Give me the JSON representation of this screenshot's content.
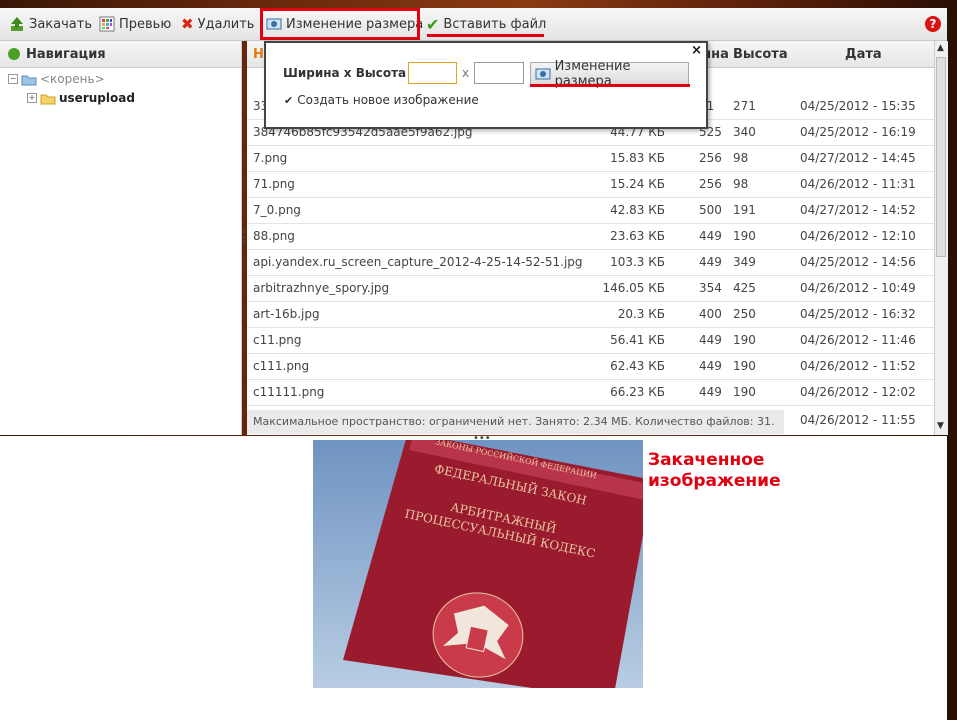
{
  "toolbar": {
    "upload_label": "Закачать",
    "preview_label": "Превью",
    "delete_label": "Удалить",
    "resize_label": "Изменение размера",
    "paste_label": "Вставить файл"
  },
  "nav": {
    "title": "Навигация",
    "root": "<корень>",
    "folder": "userupload"
  },
  "files": {
    "header": {
      "name": "Н",
      "width_tail": "ина",
      "height": "Высота",
      "date": "Дата"
    },
    "rows": [
      {
        "name": "33",
        "size": "",
        "w": "41",
        "h": "271",
        "date": "04/25/2012 - 15:35"
      },
      {
        "name": "384746b85fc93542d5aae5f9a62.jpg",
        "size": "44.77 КБ",
        "w": "525",
        "h": "340",
        "date": "04/25/2012 - 16:19"
      },
      {
        "name": "7.png",
        "size": "15.83 КБ",
        "w": "256",
        "h": "98",
        "date": "04/27/2012 - 14:45"
      },
      {
        "name": "71.png",
        "size": "15.24 КБ",
        "w": "256",
        "h": "98",
        "date": "04/26/2012 - 11:31"
      },
      {
        "name": "7_0.png",
        "size": "42.83 КБ",
        "w": "500",
        "h": "191",
        "date": "04/27/2012 - 14:52"
      },
      {
        "name": "88.png",
        "size": "23.63 КБ",
        "w": "449",
        "h": "190",
        "date": "04/26/2012 - 12:10"
      },
      {
        "name": "api.yandex.ru_screen_capture_2012-4-25-14-52-51.jpg",
        "size": "103.3 КБ",
        "w": "449",
        "h": "349",
        "date": "04/25/2012 - 14:56"
      },
      {
        "name": "arbitrazhnye_spory.jpg",
        "size": "146.05 КБ",
        "w": "354",
        "h": "425",
        "date": "04/26/2012 - 10:49"
      },
      {
        "name": "art-16b.jpg",
        "size": "20.3 КБ",
        "w": "400",
        "h": "250",
        "date": "04/25/2012 - 16:32"
      },
      {
        "name": "c11.png",
        "size": "56.41 КБ",
        "w": "449",
        "h": "190",
        "date": "04/26/2012 - 11:46"
      },
      {
        "name": "c111.png",
        "size": "62.43 КБ",
        "w": "449",
        "h": "190",
        "date": "04/26/2012 - 11:52"
      },
      {
        "name": "c11111.png",
        "size": "66.23 КБ",
        "w": "449",
        "h": "190",
        "date": "04/26/2012 - 12:02"
      }
    ],
    "last_date": "04/26/2012 - 11:55",
    "status": "Максимальное пространство: ограничений нет. Занято: 2.34 МБ. Количество файлов: 31."
  },
  "popup": {
    "label": "Ширина x Высота",
    "sep": "x",
    "width_value": "",
    "height_value": "",
    "button_label": "Изменение размера",
    "checkbox_label": "Создать новое изображение",
    "close": "×"
  },
  "preview": {
    "note_line1": "Закаченное",
    "note_line2": "изображение",
    "book_line1": "ЗАКОНЫ РОССИЙСКОЙ ФЕДЕРАЦИИ",
    "book_line2": "ФЕДЕРАЛЬНЫЙ ЗАКОН",
    "book_line3": "АРБИТРАЖНЫЙ",
    "book_line4": "ПРОЦЕССУАЛЬНЫЙ КОДЕКС"
  },
  "colors": {
    "highlight": "#e00010",
    "book": "#9b1b2e"
  }
}
